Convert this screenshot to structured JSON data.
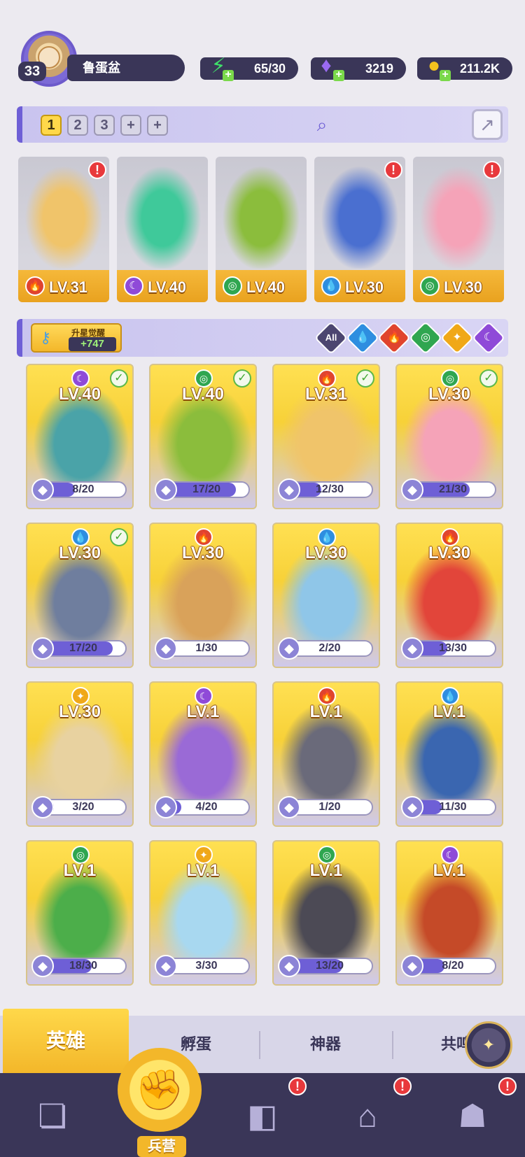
{
  "player": {
    "level": "33",
    "name": "鲁蛋盆"
  },
  "resources": {
    "energy": {
      "value": "65/30",
      "icon": "lightning-icon"
    },
    "gems": {
      "value": "3219",
      "icon": "diamond-icon"
    },
    "gold": {
      "value": "211.2K",
      "icon": "coin-icon"
    }
  },
  "team": {
    "slots": [
      "1",
      "2",
      "3",
      "+",
      "+"
    ],
    "active_slot": 0
  },
  "lineup": [
    {
      "lv": "LV.31",
      "element": "fire",
      "alert": true,
      "color": "#f0c46a"
    },
    {
      "lv": "LV.40",
      "element": "dark",
      "alert": false,
      "color": "#3fc99a"
    },
    {
      "lv": "LV.40",
      "element": "wind",
      "alert": false,
      "color": "#8bbd3c"
    },
    {
      "lv": "LV.30",
      "element": "water",
      "alert": true,
      "color": "#4a6fd0"
    },
    {
      "lv": "LV.30",
      "element": "wind",
      "alert": true,
      "color": "#f5a3b8"
    }
  ],
  "awaken": {
    "label": "升星觉醒",
    "count": "+747"
  },
  "filters": [
    "All",
    "water",
    "fire",
    "wind",
    "light",
    "dark"
  ],
  "heroes": [
    {
      "lv": "LV.40",
      "element": "dark",
      "shards": "8/20",
      "progress": 0.4,
      "checked": true,
      "color": "#4aa3a8"
    },
    {
      "lv": "LV.40",
      "element": "wind",
      "shards": "17/20",
      "progress": 0.85,
      "checked": true,
      "color": "#8bbd3c"
    },
    {
      "lv": "LV.31",
      "element": "fire",
      "shards": "12/30",
      "progress": 0.4,
      "checked": true,
      "color": "#f0c46a"
    },
    {
      "lv": "LV.30",
      "element": "wind",
      "shards": "21/30",
      "progress": 0.7,
      "checked": true,
      "color": "#f5a3b8"
    },
    {
      "lv": "LV.30",
      "element": "water",
      "shards": "17/20",
      "progress": 0.85,
      "checked": true,
      "color": "#6f7e9e"
    },
    {
      "lv": "LV.30",
      "element": "fire",
      "shards": "1/30",
      "progress": 0.03,
      "checked": false,
      "color": "#d9a25a"
    },
    {
      "lv": "LV.30",
      "element": "water",
      "shards": "2/20",
      "progress": 0.1,
      "checked": false,
      "color": "#8fc6e8"
    },
    {
      "lv": "LV.30",
      "element": "fire",
      "shards": "13/30",
      "progress": 0.43,
      "checked": false,
      "color": "#e2453a"
    },
    {
      "lv": "LV.30",
      "element": "light",
      "shards": "3/20",
      "progress": 0.15,
      "checked": false,
      "color": "#e8d2a0"
    },
    {
      "lv": "LV.1",
      "element": "dark",
      "shards": "4/20",
      "progress": 0.2,
      "checked": false,
      "color": "#9a6ad6"
    },
    {
      "lv": "LV.1",
      "element": "fire",
      "shards": "1/20",
      "progress": 0.05,
      "checked": false,
      "color": "#6a6a7a"
    },
    {
      "lv": "LV.1",
      "element": "water",
      "shards": "11/30",
      "progress": 0.37,
      "checked": false,
      "color": "#3a66b0"
    },
    {
      "lv": "LV.1",
      "element": "wind",
      "shards": "18/30",
      "progress": 0.6,
      "checked": false,
      "color": "#4cae4a"
    },
    {
      "lv": "LV.1",
      "element": "light",
      "shards": "3/30",
      "progress": 0.1,
      "checked": false,
      "color": "#a8d8f0"
    },
    {
      "lv": "LV.1",
      "element": "wind",
      "shards": "13/20",
      "progress": 0.65,
      "checked": false,
      "color": "#4c4a55"
    },
    {
      "lv": "LV.1",
      "element": "dark",
      "shards": "8/20",
      "progress": 0.4,
      "checked": false,
      "color": "#c54a28"
    }
  ],
  "tabs": {
    "heroes": "英雄",
    "hatch": "孵蛋",
    "artifacts": "神器",
    "resonance": "共鸣"
  },
  "nav": {
    "barracks": "兵营"
  }
}
